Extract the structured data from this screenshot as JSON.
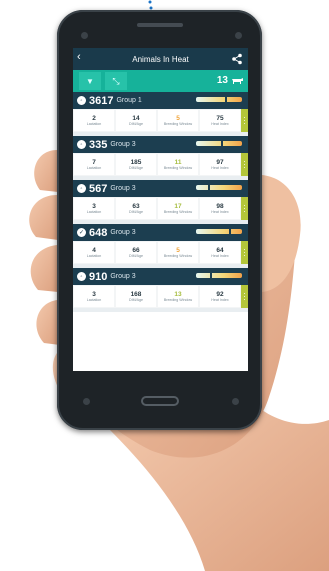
{
  "app": {
    "title": "Animals In Heat",
    "herd_count": "13"
  },
  "cards": [
    {
      "id": "3617",
      "group": "Group 1",
      "marker": 0.62,
      "lactation": "2",
      "dim": "14",
      "breeding": "5",
      "heat": "75",
      "breeding_color": "#f0a43a"
    },
    {
      "id": "335",
      "group": "Group 3",
      "marker": 0.55,
      "lactation": "7",
      "dim": "185",
      "breeding": "11",
      "heat": "97",
      "breeding_color": "#a6bd3f"
    },
    {
      "id": "567",
      "group": "Group 3",
      "marker": 0.25,
      "lactation": "3",
      "dim": "63",
      "breeding": "17",
      "heat": "98",
      "breeding_color": "#a6bd3f"
    },
    {
      "id": "648",
      "group": "Group 3",
      "marker": 0.72,
      "lactation": "4",
      "dim": "66",
      "breeding": "5",
      "heat": "64",
      "breeding_color": "#f0a43a"
    },
    {
      "id": "910",
      "group": "Group 3",
      "marker": 0.3,
      "lactation": "3",
      "dim": "168",
      "breeding": "13",
      "heat": "92",
      "breeding_color": "#a6bd3f"
    }
  ],
  "labels": {
    "lactation": "Lactation",
    "dim": "DIM/Age",
    "breeding": "Breeding Window",
    "heat": "Heat Index"
  },
  "colors": {
    "appbar": "#1a3a4b",
    "toolbar": "#16b29a",
    "card_header": "#1c3e50",
    "side_tab": "#b4c63a"
  },
  "icons": [
    "back-arrow-icon",
    "share-icon",
    "filter-icon",
    "sort-icon",
    "cow-icon",
    "more-dots-icon"
  ]
}
